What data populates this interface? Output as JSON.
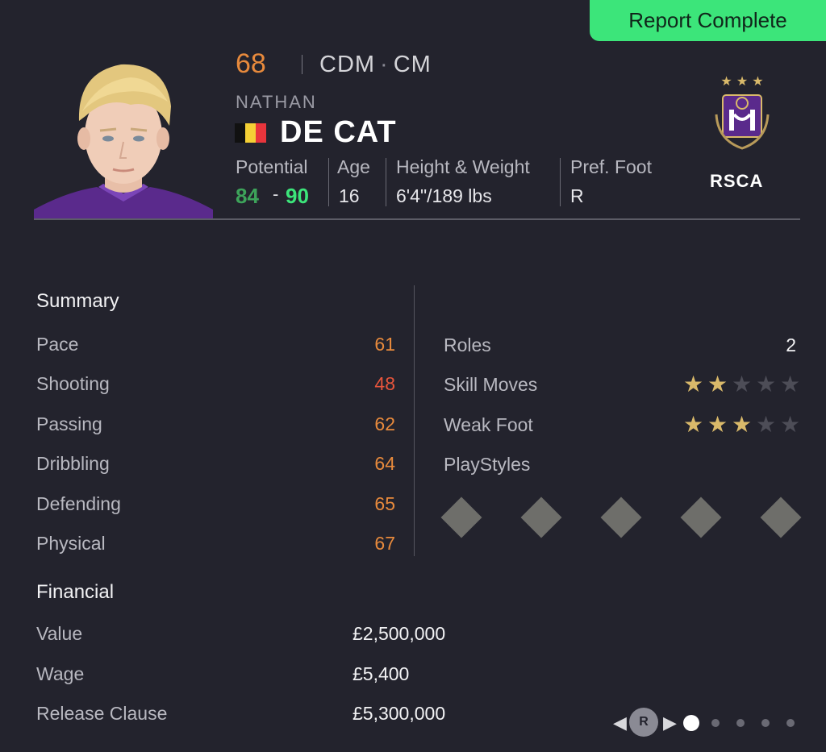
{
  "report_badge": "Report Complete",
  "player": {
    "overall": "68",
    "positions": [
      "CDM",
      "CM"
    ],
    "first_name": "NATHAN",
    "last_name": "DE CAT",
    "nationality_flag": "belgium-flag"
  },
  "info": {
    "potential_label": "Potential",
    "potential_low": "84",
    "potential_dash": "-",
    "potential_high": "90",
    "age_label": "Age",
    "age": "16",
    "height_weight_label": "Height & Weight",
    "height_weight": "6'4\"/189 lbs",
    "foot_label": "Pref. Foot",
    "foot": "R"
  },
  "club": {
    "name": "RSCA",
    "stars": 3
  },
  "summary": {
    "title": "Summary",
    "stats": [
      {
        "label": "Pace",
        "value": "61",
        "color": "#e88a3c"
      },
      {
        "label": "Shooting",
        "value": "48",
        "color": "#e8553c"
      },
      {
        "label": "Passing",
        "value": "62",
        "color": "#e88a3c"
      },
      {
        "label": "Dribbling",
        "value": "64",
        "color": "#e88a3c"
      },
      {
        "label": "Defending",
        "value": "65",
        "color": "#e88a3c"
      },
      {
        "label": "Physical",
        "value": "67",
        "color": "#e88a3c"
      }
    ]
  },
  "attributes": {
    "roles_label": "Roles",
    "roles": "2",
    "skill_moves_label": "Skill Moves",
    "skill_moves": 2,
    "weak_foot_label": "Weak Foot",
    "weak_foot": 3,
    "max_stars": 5,
    "playstyles_label": "PlayStyles",
    "playstyle_slots": 5
  },
  "financial": {
    "title": "Financial",
    "rows": [
      {
        "label": "Value",
        "value": "£2,500,000"
      },
      {
        "label": "Wage",
        "value": "£5,400"
      },
      {
        "label": "Release Clause",
        "value": "£5,300,000"
      }
    ]
  },
  "pager": {
    "button_label": "R",
    "pages": 5,
    "active": 1
  },
  "colors": {
    "accent_green": "#3ce57a",
    "potential_low": "#3da35a",
    "stat_orange": "#e88a3c",
    "stat_red": "#e8553c",
    "star_gold": "#d9b96a",
    "background": "#23232d"
  }
}
